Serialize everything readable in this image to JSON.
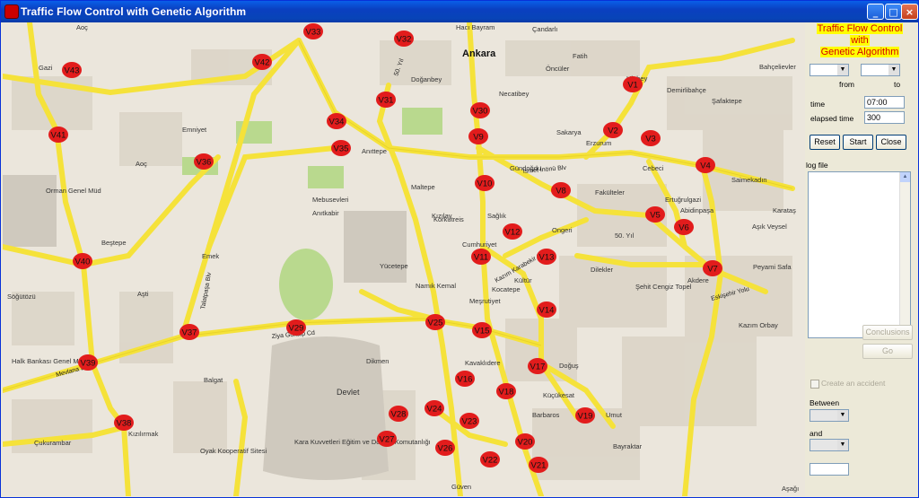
{
  "window": {
    "title": "Traffic Flow Control with Genetic Algorithm"
  },
  "panel": {
    "app_title": [
      "Traffic Flow Control",
      "with",
      "Genetic Algorithm"
    ],
    "from_label": "from",
    "to_label": "to",
    "time_label": "time",
    "time_value": "07:00",
    "elapsed_label": "elapsed time",
    "elapsed_value": "300",
    "reset_label": "Reset",
    "start_label": "Start",
    "close_label": "Close",
    "log_label": "log file",
    "conclusions_label": "Conclusions",
    "go_label": "Go",
    "accident_label": "Create an accident",
    "between_label": "Between",
    "and_label": "and"
  },
  "colors": {
    "node": "#e21c1c",
    "road": "#f5e23a",
    "park": "#b9d98e",
    "block": "#d9d1c3",
    "title_text": "#d40000",
    "title_highlight": "#ffff00"
  },
  "map": {
    "nodes": [
      "V1",
      "V2",
      "V3",
      "V4",
      "V5",
      "V6",
      "V7",
      "V8",
      "V9",
      "V10",
      "V11",
      "V12",
      "V13",
      "V14",
      "V15",
      "V16",
      "V17",
      "V18",
      "V19",
      "V20",
      "V21",
      "V22",
      "V23",
      "V24",
      "V25",
      "V26",
      "V27",
      "V28",
      "V29",
      "V30",
      "V31",
      "V32",
      "V33",
      "V34",
      "V35",
      "V36",
      "V37",
      "V38",
      "V39",
      "V40",
      "V41",
      "V42",
      "V43"
    ],
    "places": [
      "Ankara",
      "Aoç",
      "Gazi",
      "Emniyet",
      "Maltepe",
      "Anıttepe",
      "Kızılay",
      "Cumhuriyet",
      "Sağlık",
      "Kocatepe",
      "Kültür",
      "Meşrutiyet",
      "Namık Kemal",
      "Emek",
      "Beştepe",
      "Aşti",
      "Söğütözü",
      "Çukurambar",
      "Kızılırmak",
      "Balgat",
      "Dikmen",
      "Kavaklıdere",
      "Küçükesat",
      "Barbaros",
      "Umut",
      "Doğuş",
      "Bayraktar",
      "Fatih",
      "Sakarya",
      "Erzurum",
      "Cebeci",
      "Fakülteler",
      "Ertuğrulgazi",
      "Abidinpaşa",
      "Aşık Veysel",
      "Kazım Orbay",
      "Akdere",
      "Peyami Safa",
      "Şafaktepe",
      "Demirlibahçe",
      "Bahçelievler",
      "Saimekadın",
      "Karataş",
      "Yücetepe",
      "Mebusevleri",
      "Anıtkabir",
      "Devlet",
      "Güven",
      "Hacı Bayram",
      "Doğanbey",
      "Necatibey",
      "Öncüler",
      "Çandarlı",
      "Ulubey",
      "Aşağı",
      "Gündoğdu",
      "Korkutreis",
      "Ongeri",
      "Dilekler",
      "Şehit Cengiz Topel",
      "Orman Genel Müd",
      "Halk Bankası Genel Müd",
      "Kara Kuvvetleri Eğitim ve Doktrin Komutanlığı",
      "Oyak Kooperatif Sitesi",
      "50. Yıl",
      "Kazım Karabekir Cd",
      "Ziya Gökalp Cd",
      "İsmet İnönü Blv",
      "Talatpaşa Blv",
      "Mevlana Blv",
      "Eskişehir Yolu",
      "Mehmet Akif Cd"
    ]
  }
}
